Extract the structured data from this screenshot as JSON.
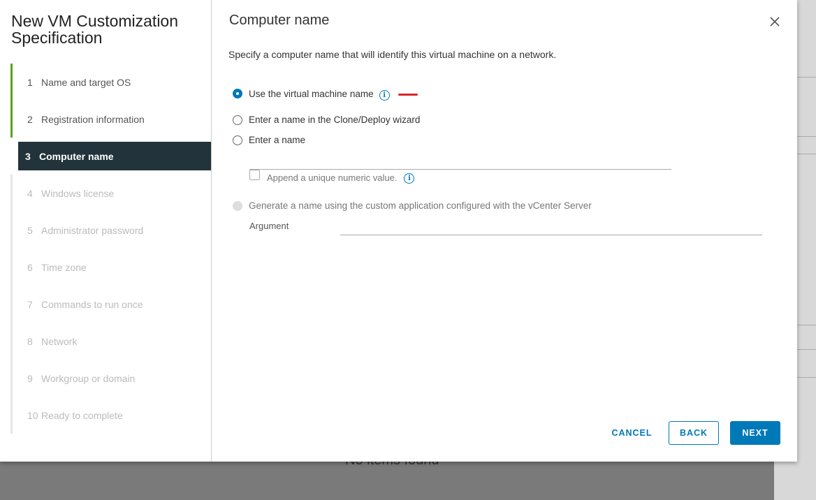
{
  "background": {
    "empty_text": "No items found"
  },
  "wizard": {
    "title": "New VM Customization Specification",
    "steps": [
      {
        "num": "1",
        "label": "Name and target OS",
        "state": "done"
      },
      {
        "num": "2",
        "label": "Registration information",
        "state": "done"
      },
      {
        "num": "3",
        "label": "Computer name",
        "state": "active"
      },
      {
        "num": "4",
        "label": "Windows license",
        "state": "pending"
      },
      {
        "num": "5",
        "label": "Administrator password",
        "state": "pending"
      },
      {
        "num": "6",
        "label": "Time zone",
        "state": "pending"
      },
      {
        "num": "7",
        "label": "Commands to run once",
        "state": "pending"
      },
      {
        "num": "8",
        "label": "Network",
        "state": "pending"
      },
      {
        "num": "9",
        "label": "Workgroup or domain",
        "state": "pending"
      },
      {
        "num": "10",
        "label": "Ready to complete",
        "state": "pending"
      }
    ]
  },
  "page": {
    "title": "Computer name",
    "description": "Specify a computer name that will identify this virtual machine on a network.",
    "options": {
      "use_vm_name": "Use the virtual machine name",
      "enter_in_wizard": "Enter a name in the Clone/Deploy wizard",
      "enter_name": "Enter a name",
      "append_numeric": "Append a unique numeric value.",
      "generate_custom": "Generate a name using the custom application configured with the vCenter Server",
      "argument_label": "Argument"
    },
    "name_value": "",
    "argument_value": ""
  },
  "footer": {
    "cancel": "CANCEL",
    "back": "BACK",
    "next": "NEXT"
  },
  "colors": {
    "accent": "#0079b8",
    "done": "#5aa220",
    "active_bg": "#22333b",
    "marker": "#d6262b"
  },
  "icons": {
    "close": "close-icon",
    "info": "info-icon"
  }
}
